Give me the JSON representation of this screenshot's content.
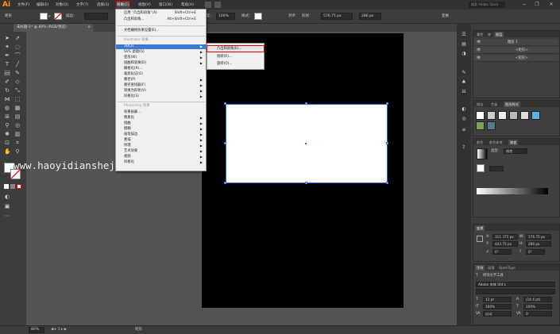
{
  "menubar": {
    "logo": "Ai",
    "items": [
      "文件(F)",
      "编辑(E)",
      "对象(O)",
      "文字(T)",
      "选择(S)",
      "效果(C)",
      "视图(V)",
      "窗口(W)",
      "帮助(H)"
    ],
    "search_placeholder": "搜索 Adobe Stock",
    "window_controls": [
      "−",
      "❐",
      "✕"
    ]
  },
  "control_bar": {
    "label_rect": "矩形",
    "stroke_label": "描边：",
    "opacity_label": "不透明度：",
    "opacity_value": "100%",
    "style_label": "样式：",
    "align_label": "对齐",
    "shape_label": "形状：",
    "width_value": "576.75 px",
    "height_value": "286 px",
    "transform_label": "变换"
  },
  "document_tab": {
    "title": "未标题-1* @ 80% (RGB/预览)",
    "close": "×"
  },
  "status_bar": {
    "zoom": "80%",
    "tool": "矩形"
  },
  "watermark": "www.haoyidianshejishi.com",
  "effect_menu": {
    "apply_last": "应用 \"凸出和斜角\"(A)",
    "apply_last_shortcut": "Shift+Ctrl+E",
    "last_effect": "凸出和斜角...",
    "last_effect_shortcut": "Alt+Shift+Ctrl+E",
    "document_raster": "文档栅格效果设置(E)...",
    "illustrator_header": "Illustrator 效果",
    "illustrator_items": [
      "3D(3)",
      "SVG 滤镜(G)",
      "变形(W)",
      "扭曲和变换(D)",
      "栅格化(R)...",
      "裁剪标记(O)",
      "路径(P)",
      "路径查找器(F)",
      "转换为形状(V)",
      "风格化(S)"
    ],
    "illustrator_has_submenu": [
      true,
      true,
      true,
      true,
      false,
      false,
      true,
      true,
      true,
      true
    ],
    "photoshop_header": "Photoshop 效果",
    "photoshop_items": [
      "效果画廊...",
      "像素化",
      "扭曲",
      "模糊",
      "画笔描边",
      "素描",
      "纹理",
      "艺术效果",
      "视频",
      "风格化"
    ],
    "photoshop_has_submenu": [
      false,
      true,
      true,
      true,
      true,
      true,
      true,
      true,
      true,
      true
    ]
  },
  "submenu_3d": {
    "items": [
      "凸出和斜角(E)...",
      "绕转(R)...",
      "旋转(O)..."
    ]
  },
  "right_panels": {
    "layers_tabs": [
      "属性",
      "库",
      "图层"
    ],
    "layers_rows": [
      {
        "name": "图层 1"
      },
      {
        "name": "<矩形>"
      },
      {
        "name": "<矩形>"
      }
    ],
    "swatches_tabs": [
      "描边",
      "色板",
      "图形样式"
    ],
    "gradient_tabs": [
      "颜色",
      "颜色参考",
      "渐变"
    ],
    "gradient_type_label": "类型：",
    "gradient_type_value": "线性",
    "transform_tabs": [
      "变换"
    ],
    "transform_x": "311.375 px",
    "transform_w": "576.75 px",
    "transform_y": "443.75 px",
    "transform_h": "286 px",
    "transform_angle": "0°",
    "transform_shear": "0°",
    "character_tabs": [
      "字符",
      "段落",
      "OpenType"
    ],
    "touch_type": "修饰文字工具",
    "font_name": "Adobe 宋体 Std L",
    "font_size": "12 pt",
    "leading": "(14.4 pt)",
    "tracking": "0",
    "kerning": "自动",
    "scale_h": "100%",
    "scale_v": "100%"
  },
  "colors": {
    "menu_highlight": "#3c7ad6",
    "annotation_red": "#e00000",
    "artboard": "#000000",
    "selection": "#3a6ad8"
  }
}
